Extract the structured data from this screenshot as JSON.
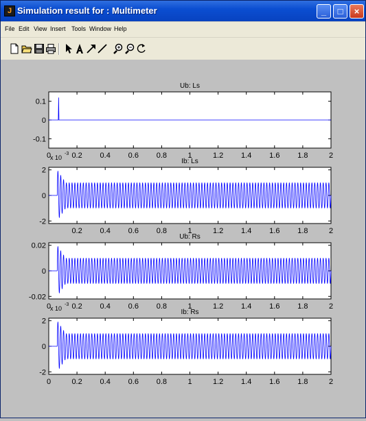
{
  "window": {
    "title": "Simulation result for : Multimeter",
    "app_icon": "matlab-logo-icon",
    "controls": [
      "minimize-icon",
      "maximize-icon",
      "close-icon"
    ]
  },
  "menu": [
    "File",
    "Edit",
    "View",
    "Insert",
    "Tools",
    "Window",
    "Help"
  ],
  "toolbar": [
    "new-file-icon",
    "open-folder-icon",
    "save-icon",
    "print-icon",
    "pointer-arrow-icon",
    "text-A-icon",
    "draw-arrow-icon",
    "draw-line-icon",
    "zoom-in-icon",
    "zoom-out-icon",
    "rotate-3d-icon"
  ],
  "colors": {
    "trace": "#0000ff",
    "axes_bg": "#ffffff",
    "figure_bg": "#c0c0c0"
  },
  "chart_data": [
    {
      "type": "line",
      "title": "Ub: Ls",
      "xlim": [
        0,
        2
      ],
      "ylim": [
        -0.15,
        0.15
      ],
      "x_ticks": [
        "0",
        "0.2",
        "0.4",
        "0.6",
        "0.8",
        "1",
        "1.2",
        "1.4",
        "1.6",
        "1.8",
        "2"
      ],
      "y_ticks": [
        "0.1",
        "0",
        "-0.1"
      ],
      "y_tick_values": [
        0.1,
        0,
        -0.1
      ],
      "exponent_label": "x 10",
      "exponent_power": "-3",
      "signal": {
        "kind": "spike_then_zero",
        "spike_x": 0.07,
        "spike_amplitude": 0.12
      }
    },
    {
      "type": "line",
      "title": "Ib: Ls",
      "xlim": [
        0,
        2
      ],
      "ylim": [
        -2.2,
        2.2
      ],
      "x_ticks": [
        "0.2",
        "0.4",
        "0.6",
        "0.8",
        "1",
        "1.2",
        "1.4",
        "1.6",
        "1.8",
        "2"
      ],
      "y_ticks": [
        "2",
        "0",
        "-2"
      ],
      "y_tick_values": [
        2,
        0,
        -2
      ],
      "signal": {
        "kind": "oscillation",
        "steady_amplitude": 1.0,
        "cycles": 100,
        "transient_start": 0.06,
        "transient_end": 0.12,
        "transient_peak": 2.0
      }
    },
    {
      "type": "line",
      "title": "Ub: Rs",
      "xlim": [
        0,
        2
      ],
      "ylim": [
        -0.022,
        0.022
      ],
      "x_ticks": [
        "0",
        "0.2",
        "0.4",
        "0.6",
        "0.8",
        "1",
        "1.2",
        "1.4",
        "1.6",
        "1.8",
        "2"
      ],
      "y_ticks": [
        "0.02",
        "0",
        "-0.02"
      ],
      "y_tick_values": [
        0.02,
        0,
        -0.02
      ],
      "exponent_label": "x 10",
      "exponent_power": "-3",
      "signal": {
        "kind": "oscillation",
        "steady_amplitude": 0.01,
        "cycles": 100,
        "transient_start": 0.06,
        "transient_end": 0.12,
        "transient_peak": 0.02
      }
    },
    {
      "type": "line",
      "title": "Ib: Rs",
      "xlim": [
        0,
        2
      ],
      "ylim": [
        -2.2,
        2.2
      ],
      "x_ticks": [
        "0",
        "0.2",
        "0.4",
        "0.6",
        "0.8",
        "1",
        "1.2",
        "1.4",
        "1.6",
        "1.8",
        "2"
      ],
      "y_ticks": [
        "2",
        "0",
        "-2"
      ],
      "y_tick_values": [
        2,
        0,
        -2
      ],
      "signal": {
        "kind": "oscillation",
        "steady_amplitude": 1.0,
        "cycles": 100,
        "transient_start": 0.06,
        "transient_end": 0.12,
        "transient_peak": 2.0
      }
    }
  ]
}
